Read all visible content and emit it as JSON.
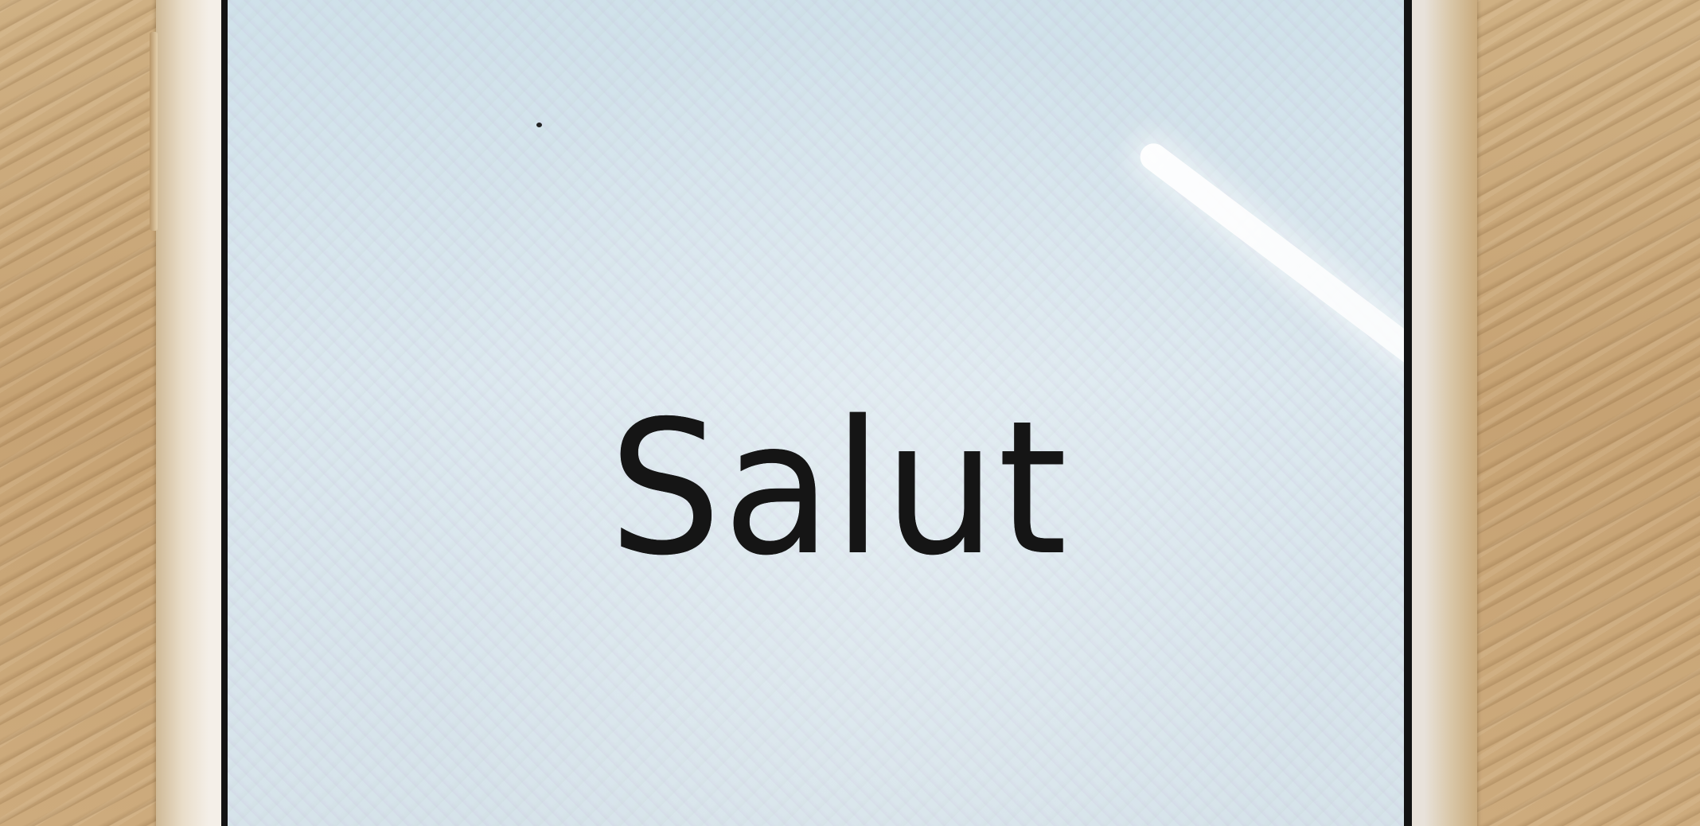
{
  "screen": {
    "greeting": "Salut"
  },
  "colors": {
    "screen_background": "#d6e3ea",
    "text": "#141414",
    "device_frame": "#f4efe8",
    "desk": "#c9a77a"
  }
}
